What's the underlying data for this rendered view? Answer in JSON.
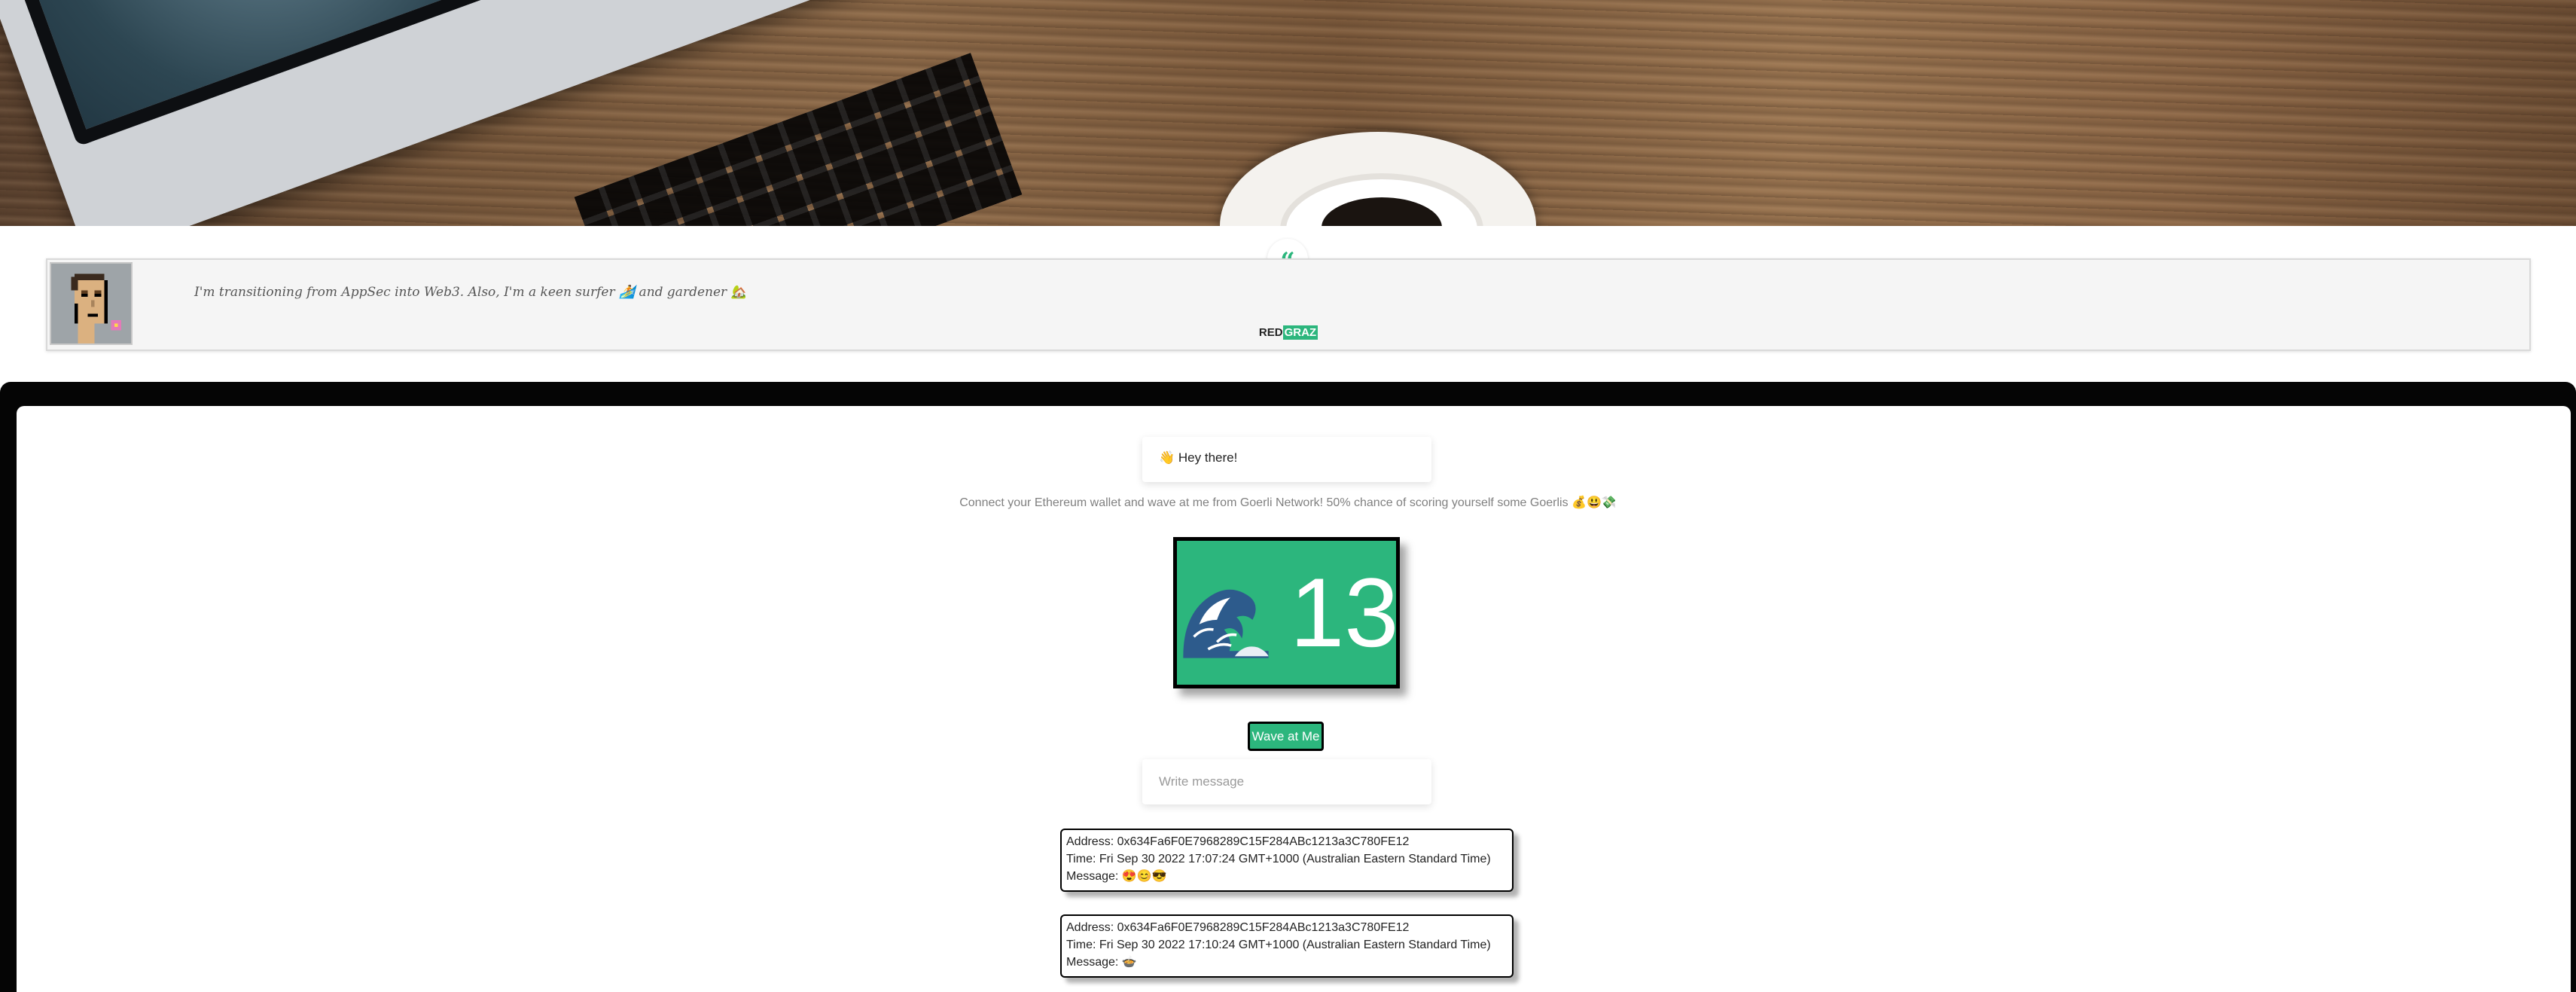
{
  "quote": {
    "text": "I'm transitioning from AppSec into Web3. Also, I'm a keen surfer 🏄 and gardener 🏡",
    "author_prefix": "RED",
    "author_highlight": "GRAZ",
    "badge_icon": "“"
  },
  "greeting": "👋 Hey there!",
  "subtitle": "Connect your Ethereum wallet and wave at me from Goerli Network! 50% chance of scoring yourself some Goerlis 💰😃💸",
  "counter": {
    "icon": "wave-emoji",
    "count": "13"
  },
  "wave_button": "Wave at Me",
  "message_input": {
    "placeholder": "Write message",
    "value": ""
  },
  "waves": [
    {
      "address": "Address: 0x634Fa6F0E7968289C15F284ABc1213a3C780FE12",
      "time": "Time: Fri Sep 30 2022 17:07:24 GMT+1000 (Australian Eastern Standard Time)",
      "message": "Message: 😍😊😎"
    },
    {
      "address": "Address: 0x634Fa6F0E7968289C15F284ABc1213a3C780FE12",
      "time": "Time: Fri Sep 30 2022 17:10:24 GMT+1000 (Australian Eastern Standard Time)",
      "message": "Message: 🍲"
    }
  ],
  "colors": {
    "accent": "#2cb67d",
    "frame": "#050505"
  }
}
